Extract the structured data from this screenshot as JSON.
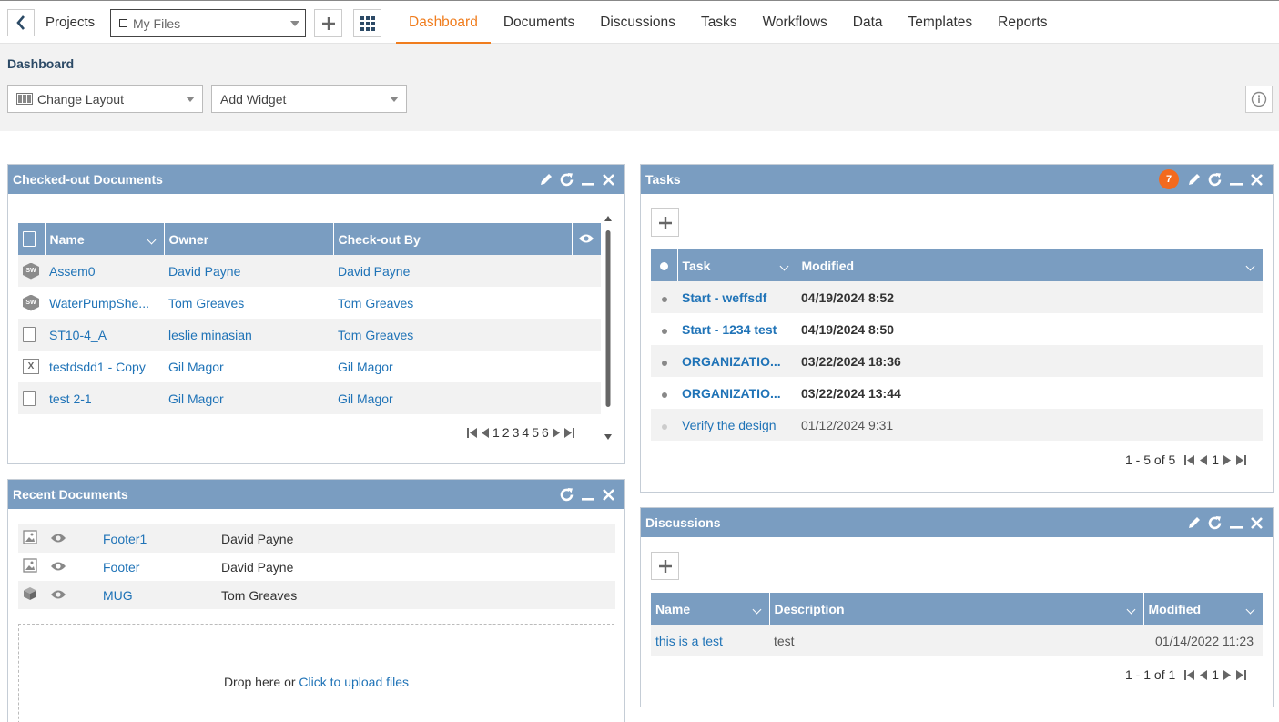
{
  "topbar": {
    "projects_label": "Projects",
    "files_select": "My Files",
    "tabs": [
      "Dashboard",
      "Documents",
      "Discussions",
      "Tasks",
      "Workflows",
      "Data",
      "Templates",
      "Reports"
    ],
    "active_tab": "Dashboard"
  },
  "subheader": {
    "title": "Dashboard",
    "change_layout": "Change Layout",
    "add_widget": "Add Widget"
  },
  "checked_out": {
    "title": "Checked-out Documents",
    "columns": [
      "Name",
      "Owner",
      "Check-out By"
    ],
    "rows": [
      {
        "icon": "solidworks-icon",
        "name": "Assem0",
        "owner": "David Payne",
        "by": "David Payne"
      },
      {
        "icon": "solidworks-icon",
        "name": "WaterPumpShe...",
        "owner": "Tom Greaves",
        "by": "Tom Greaves"
      },
      {
        "icon": "file-icon",
        "name": "ST10-4_A",
        "owner": "leslie minasian",
        "by": "Tom Greaves"
      },
      {
        "icon": "excel-icon",
        "name": "testdsdd1 - Copy",
        "owner": "Gil Magor",
        "by": "Gil Magor"
      },
      {
        "icon": "file-icon",
        "name": "test 2-1",
        "owner": "Gil Magor",
        "by": "Gil Magor"
      }
    ],
    "pages": [
      "1",
      "2",
      "3",
      "4",
      "5",
      "6"
    ]
  },
  "recent": {
    "title": "Recent Documents",
    "rows": [
      {
        "icon": "image-icon",
        "name": "Footer1",
        "owner": "David Payne"
      },
      {
        "icon": "image-icon",
        "name": "Footer",
        "owner": "David Payne"
      },
      {
        "icon": "cube-icon",
        "name": "MUG",
        "owner": "Tom Greaves"
      }
    ],
    "drop_text": "Drop here or ",
    "upload_link": "Click to upload files"
  },
  "tasks": {
    "title": "Tasks",
    "badge": "7",
    "columns": [
      "Task",
      "Modified"
    ],
    "rows": [
      {
        "task": "Start - weffsdf",
        "modified": "04/19/2024 8:52",
        "bold": true
      },
      {
        "task": "Start - 1234 test",
        "modified": "04/19/2024 8:50",
        "bold": true
      },
      {
        "task": "ORGANIZATIO...",
        "modified": "03/22/2024 18:36",
        "bold": true
      },
      {
        "task": "ORGANIZATIO...",
        "modified": "03/22/2024 13:44",
        "bold": true
      },
      {
        "task": "Verify the design",
        "modified": "01/12/2024 9:31",
        "bold": false
      }
    ],
    "pager_text": "1 - 5 of 5",
    "page": "1"
  },
  "discussions": {
    "title": "Discussions",
    "columns": [
      "Name",
      "Description",
      "Modified"
    ],
    "rows": [
      {
        "name": "this is a test",
        "description": "test",
        "modified": "01/14/2022 11:23"
      }
    ],
    "pager_text": "1 - 1 of 1",
    "page": "1"
  },
  "colors": {
    "accent": "#f07d1e",
    "header_blue": "#7a9dc1",
    "link": "#1f73b7",
    "badge": "#f36a1e"
  }
}
